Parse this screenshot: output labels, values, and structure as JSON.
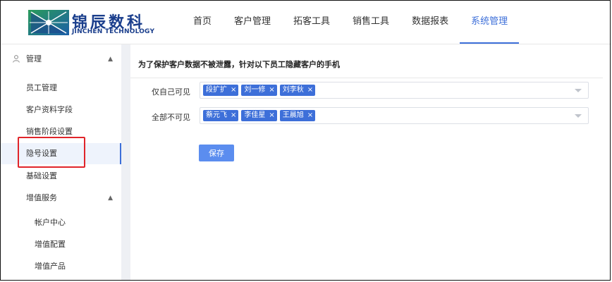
{
  "brand": {
    "name_cn": "锦辰数科",
    "name_en": "JINCHEN TECHNOLOGY",
    "color": "#1a3e8c"
  },
  "nav": [
    {
      "label": "首页",
      "active": false
    },
    {
      "label": "客户管理",
      "active": false
    },
    {
      "label": "拓客工具",
      "active": false
    },
    {
      "label": "销售工具",
      "active": false
    },
    {
      "label": "数据报表",
      "active": false
    },
    {
      "label": "系统管理",
      "active": true
    }
  ],
  "sidebar": {
    "group_manage": {
      "label": "管理",
      "icon": "user-icon",
      "expanded": true
    },
    "items": [
      {
        "label": "员工管理"
      },
      {
        "label": "客户资料字段"
      },
      {
        "label": "销售阶段设置"
      },
      {
        "label": "隐号设置",
        "active": true
      },
      {
        "label": "基础设置"
      }
    ],
    "group_value": {
      "label": "增值服务",
      "expanded": true
    },
    "sub_items": [
      {
        "label": "帐户中心"
      },
      {
        "label": "增值配置"
      },
      {
        "label": "增值产品"
      }
    ]
  },
  "main": {
    "title": "为了保护客户数据不被泄露，针对以下员工隐藏客户的手机",
    "rows": [
      {
        "label": "仅自己可见",
        "tags": [
          "段扩扩",
          "刘一修",
          "刘李秋"
        ]
      },
      {
        "label": "全部不可见",
        "tags": [
          "蔡元飞",
          "李佳星",
          "王晨旭"
        ]
      }
    ],
    "save_label": "保存",
    "tag_close": "×"
  },
  "colors": {
    "accent": "#3d6fd9",
    "highlight": "#e0242a",
    "button": "#5b8def"
  }
}
